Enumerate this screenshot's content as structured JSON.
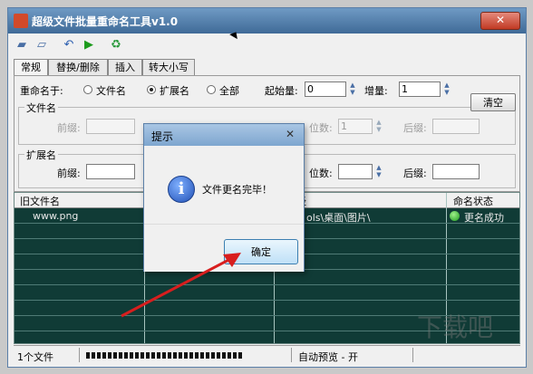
{
  "window": {
    "title": "超级文件批量重命名工具v1.0",
    "close_label": "✕"
  },
  "toolbar": {
    "icons": [
      "open-folder-icon",
      "open-file-icon",
      "undo-icon",
      "run-icon",
      "recycle-icon"
    ]
  },
  "tabs": [
    "常规",
    "替换/删除",
    "插入",
    "转大小写"
  ],
  "rename_panel": {
    "rename_in_label": "重命名于:",
    "options": [
      "文件名",
      "扩展名",
      "全部"
    ],
    "selected": "扩展名",
    "start_label": "起始量:",
    "start_value": "0",
    "increment_label": "增量:",
    "increment_value": "1",
    "clear_button": "清空"
  },
  "filename_group": {
    "title": "文件名",
    "prefix_label": "前缀:",
    "prefix_value": "",
    "digits_label": "位数:",
    "digits_value": "1",
    "suffix_label": "后缀:",
    "suffix_value": ""
  },
  "ext_group": {
    "title": "扩展名",
    "prefix_label": "前缀:",
    "prefix_value": "",
    "digits_label": "位数:",
    "digits_value": "",
    "suffix_label": "后缀:",
    "suffix_value": ""
  },
  "grid": {
    "columns": [
      "旧文件名",
      "",
      "路径",
      "命名状态"
    ],
    "rows": [
      {
        "old_name": "www.png",
        "path": "ols\\桌面\\图片\\",
        "status": "更名成功"
      }
    ]
  },
  "statusbar": {
    "file_count": "1个文件",
    "progress": 1.0,
    "auto_preview": "自动预览 - 开"
  },
  "dialog": {
    "title": "提示",
    "close_label": "✕",
    "message": "文件更名完毕！",
    "ok_button": "确定"
  },
  "watermark": "下载吧",
  "colors": {
    "title_bar": "#4f7aa5",
    "grid_bg": "#103b36",
    "annotation_arrow": "#d81e1e",
    "status_ok": "#1d9b1d"
  }
}
